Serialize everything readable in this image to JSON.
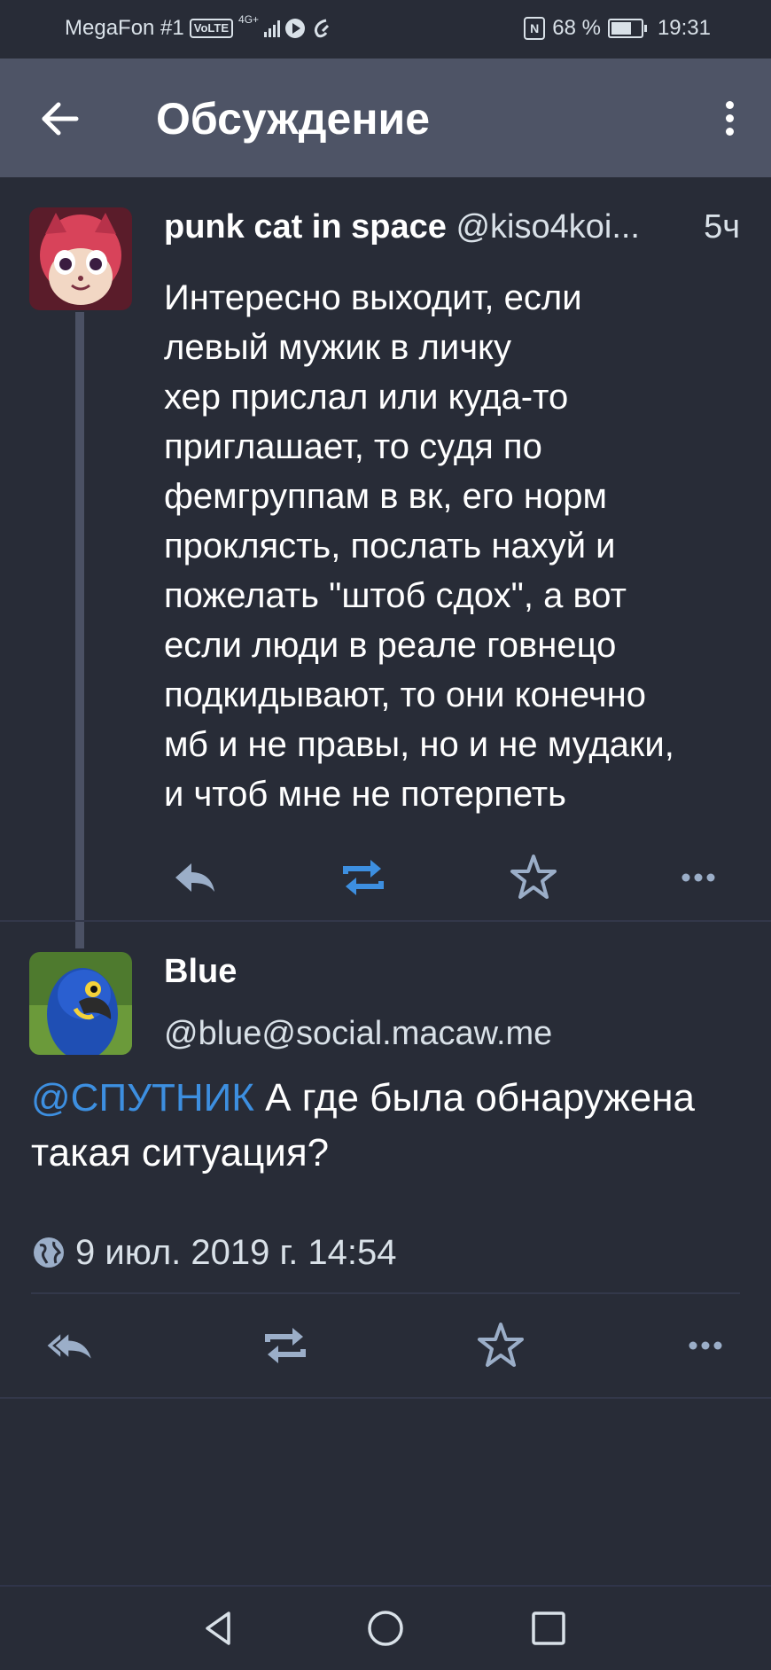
{
  "status_bar": {
    "carrier": "MegaFon #1",
    "volte": "VoLTE",
    "network": "4G+",
    "nfc": "N",
    "battery": "68 %",
    "time": "19:31"
  },
  "app_bar": {
    "title": "Обсуждение"
  },
  "statuses": [
    {
      "display_name": "punk cat in space",
      "acct": "@kiso4koi...",
      "time": "5ч",
      "text": "Интересно выходит, если\nлевый мужик в личку\nхер прислал или куда-то\nприглашает, то судя по\nфемгруппам в вк, его норм\nпроклясть, послать нахуй и\nпожелать \"штоб сдох\", а вот\nесли люди в реале говнецо\nподкидывают, то они конечно\nмб и не правы, но и не мудаки,\nи чтоб мне не потерпеть"
    },
    {
      "display_name": "Blue",
      "acct": "@blue@social.macaw.me",
      "mention": "@СПУТНИК",
      "text": " А где была обнаружена такая ситуация?",
      "timestamp": "9 июл. 2019 г. 14:54"
    }
  ],
  "colors": {
    "background": "#282c37",
    "app_bar": "#4e5466",
    "boost_active": "#3d8fe0",
    "icon_muted": "#9baec8",
    "mention": "#3d8fe0"
  }
}
